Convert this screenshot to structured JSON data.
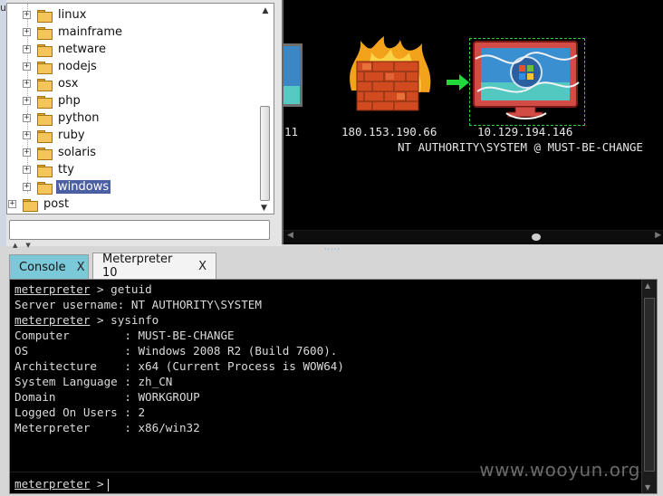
{
  "module_tree": {
    "items": [
      {
        "label": "linux",
        "expander": "+"
      },
      {
        "label": "mainframe",
        "expander": "+"
      },
      {
        "label": "netware",
        "expander": "+"
      },
      {
        "label": "nodejs",
        "expander": "+"
      },
      {
        "label": "osx",
        "expander": "+"
      },
      {
        "label": "php",
        "expander": "+"
      },
      {
        "label": "python",
        "expander": "+"
      },
      {
        "label": "ruby",
        "expander": "+"
      },
      {
        "label": "solaris",
        "expander": "+"
      },
      {
        "label": "tty",
        "expander": "+"
      },
      {
        "label": "windows",
        "expander": "+",
        "selected": true
      },
      {
        "label": "post",
        "expander": "+"
      }
    ],
    "search": {
      "value": "",
      "placeholder": ""
    },
    "left_stub_text": "u"
  },
  "graph": {
    "partial_host_label": "11",
    "firewall_host_label": "180.153.190.66",
    "target_host_label": "10.129.194.146",
    "target_session_label": "NT AUTHORITY\\SYSTEM @ MUST-BE-CHANGE",
    "colors": {
      "background": "#000000",
      "selection": "#2fd13a",
      "pivot_arrow": "#22d83a"
    }
  },
  "tabs": [
    {
      "label": "Console",
      "close": "X",
      "active": false
    },
    {
      "label": "Meterpreter 10",
      "close": "X",
      "active": true
    }
  ],
  "console": {
    "lines": [
      {
        "prompt": "meterpreter",
        "text": " > getuid"
      },
      {
        "prompt": "",
        "text": "Server username: NT AUTHORITY\\SYSTEM"
      },
      {
        "prompt": "meterpreter",
        "text": " > sysinfo"
      },
      {
        "prompt": "",
        "text": "Computer        : MUST-BE-CHANGE"
      },
      {
        "prompt": "",
        "text": "OS              : Windows 2008 R2 (Build 7600)."
      },
      {
        "prompt": "",
        "text": "Architecture    : x64 (Current Process is WOW64)"
      },
      {
        "prompt": "",
        "text": "System Language : zh_CN"
      },
      {
        "prompt": "",
        "text": "Domain          : WORKGROUP"
      },
      {
        "prompt": "",
        "text": "Logged On Users : 2"
      },
      {
        "prompt": "",
        "text": "Meterpreter     : x86/win32"
      }
    ],
    "input_prompt": "meterpreter",
    "input_suffix": " >",
    "input_value": ""
  },
  "watermark": "www.wooyun.org"
}
